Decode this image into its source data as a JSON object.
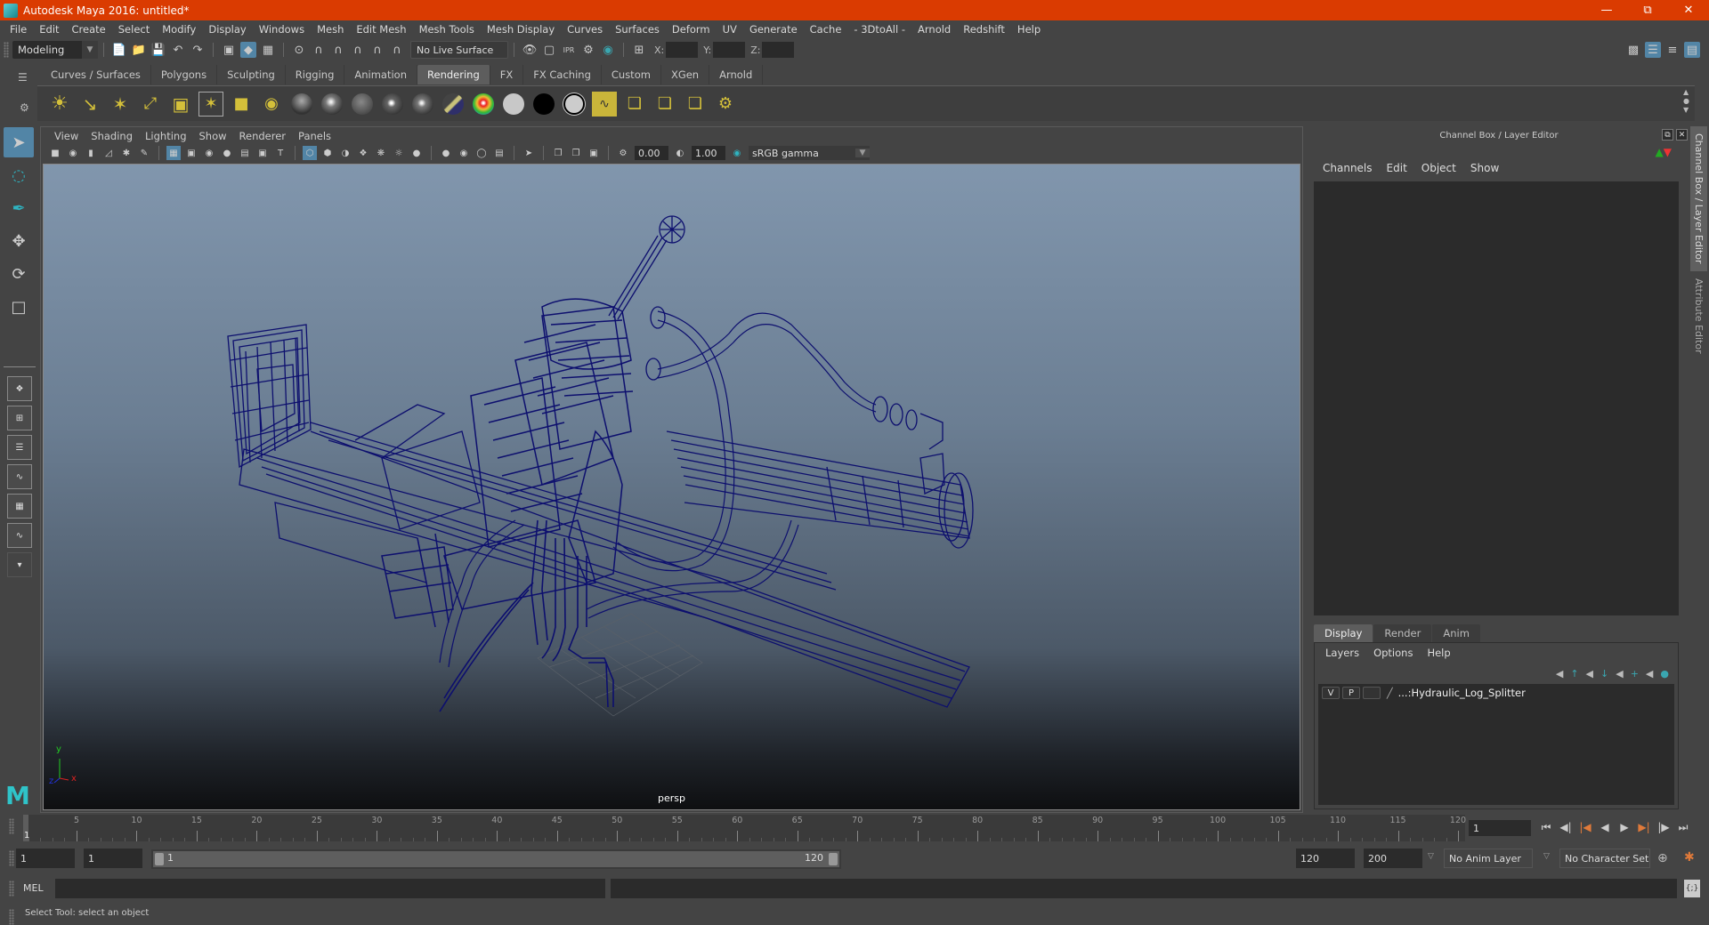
{
  "window": {
    "title": "Autodesk Maya 2016: untitled*",
    "controls": [
      "minimize",
      "restore",
      "close"
    ]
  },
  "menubar": [
    "File",
    "Edit",
    "Create",
    "Select",
    "Modify",
    "Display",
    "Windows",
    "Mesh",
    "Edit Mesh",
    "Mesh Tools",
    "Mesh Display",
    "Curves",
    "Surfaces",
    "Deform",
    "UV",
    "Generate",
    "Cache",
    "- 3DtoAll -",
    "Arnold",
    "Redshift",
    "Help"
  ],
  "statusline": {
    "mode": "Modeling",
    "live_surface": "No Live Surface",
    "x_label": "X:",
    "y_label": "Y:",
    "z_label": "Z:",
    "x_value": "",
    "y_value": "",
    "z_value": ""
  },
  "shelf": {
    "tabs": [
      "Curves / Surfaces",
      "Polygons",
      "Sculpting",
      "Rigging",
      "Animation",
      "Rendering",
      "FX",
      "FX Caching",
      "Custom",
      "XGen",
      "Arnold"
    ],
    "active_tab": "Rendering",
    "icons": [
      "ambient-light",
      "directional-light",
      "point-light",
      "spot-light",
      "area-light",
      "volume-light",
      "light-linking",
      "hypershade",
      "anisotropic-shader",
      "blinn-shader",
      "lambert-shader",
      "phong-shader",
      "phonge-shader",
      "layered-shader",
      "ramp-shader",
      "surface-shader",
      "use-background",
      "shading-map",
      "render-view",
      "render-current-frame",
      "ipr-render",
      "batch-render",
      "render-settings"
    ]
  },
  "toolbox": {
    "tools": [
      "select-tool",
      "lasso-tool",
      "paint-select-tool",
      "move-tool",
      "rotate-tool",
      "scale-tool"
    ],
    "active_tool": "select-tool"
  },
  "panel": {
    "menu": [
      "View",
      "Shading",
      "Lighting",
      "Show",
      "Renderer",
      "Panels"
    ],
    "exposure": "0.00",
    "gamma": "1.00",
    "color_space": "sRGB gamma",
    "camera": "persp",
    "axis": {
      "x": "x",
      "y": "y",
      "z": "z"
    },
    "model_color": "#0d0f6e"
  },
  "channel_box": {
    "header": "Channel Box / Layer Editor",
    "menu": [
      "Channels",
      "Edit",
      "Object",
      "Show"
    ]
  },
  "layer_editor": {
    "tabs": [
      "Display",
      "Render",
      "Anim"
    ],
    "active_tab": "Display",
    "menu": [
      "Layers",
      "Options",
      "Help"
    ],
    "layers": [
      {
        "visible": "V",
        "playback": "P",
        "name": "...:Hydraulic_Log_Splitter"
      }
    ]
  },
  "side_tabs": [
    "Channel Box / Layer Editor",
    "Attribute Editor"
  ],
  "timeline": {
    "start": 1,
    "end": 120,
    "current_frame": "1",
    "ticks": [
      5,
      10,
      15,
      20,
      25,
      30,
      35,
      40,
      45,
      50,
      55,
      60,
      65,
      70,
      75,
      80,
      85,
      90,
      95,
      100,
      105,
      110,
      115,
      120
    ]
  },
  "range": {
    "start_time": "1",
    "playback_start": "1",
    "slider_start": "1",
    "slider_end": "120",
    "playback_end": "120",
    "end_time": "200",
    "anim_layer": "No Anim Layer",
    "character_set": "No Character Set"
  },
  "command_line": {
    "label": "MEL",
    "input": "",
    "output": ""
  },
  "help_line": "Select Tool: select an object"
}
